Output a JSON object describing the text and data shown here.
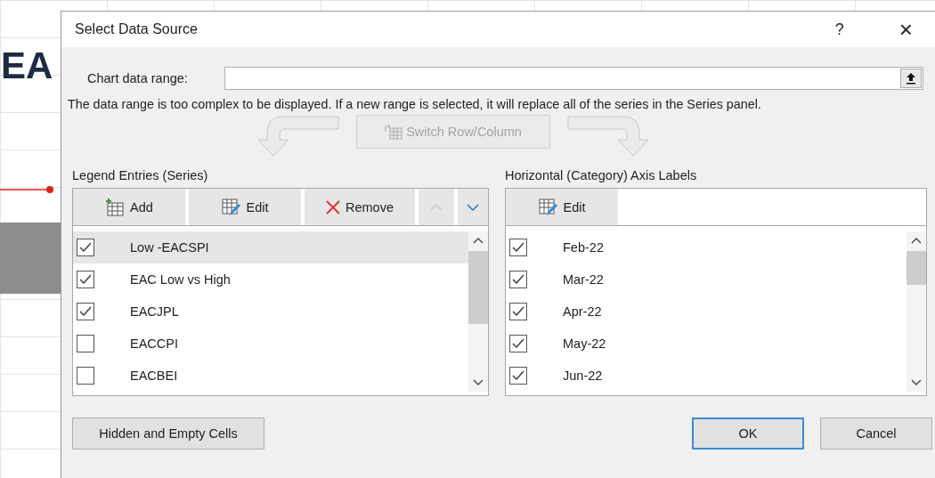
{
  "background": {
    "heading_fragment": "EA"
  },
  "window": {
    "title": "Select Data Source",
    "help": "?",
    "close": "×"
  },
  "chart_data_range": {
    "label": "Chart data range:"
  },
  "message": "The data range is too complex to be displayed. If a new range is selected, it will replace all of the series in the Series panel.",
  "switch_button": {
    "label": "Switch Row/Column",
    "disabled": true
  },
  "legend_entries": {
    "label": "Legend Entries (Series)",
    "toolbar": [
      {
        "kind": "add",
        "label": "Add"
      },
      {
        "kind": "edit",
        "label": "Edit"
      },
      {
        "kind": "remove",
        "label": "Remove"
      },
      {
        "kind": "up",
        "disabled": true
      },
      {
        "kind": "down",
        "disabled": false
      }
    ],
    "items": [
      {
        "label": "Low -EACSPI",
        "checked": true,
        "selected": true
      },
      {
        "label": "EAC Low vs High",
        "checked": true,
        "selected": false
      },
      {
        "label": "EACJPL",
        "checked": true,
        "selected": false
      },
      {
        "label": "EACCPI",
        "checked": false,
        "selected": false
      },
      {
        "label": "EACBEI",
        "checked": false,
        "selected": false
      }
    ]
  },
  "axis_labels": {
    "label": "Horizontal (Category) Axis Labels",
    "toolbar": [
      {
        "kind": "edit",
        "label": "Edit"
      }
    ],
    "items": [
      {
        "label": "Feb-22",
        "checked": true,
        "selected": false
      },
      {
        "label": "Mar-22",
        "checked": true,
        "selected": false
      },
      {
        "label": "Apr-22",
        "checked": true,
        "selected": false
      },
      {
        "label": "May-22",
        "checked": true,
        "selected": false
      },
      {
        "label": "Jun-22",
        "checked": true,
        "selected": false
      }
    ]
  },
  "footer_buttons": [
    {
      "label": "Hidden and Empty Cells",
      "default": false
    },
    {
      "label": "OK",
      "default": true
    },
    {
      "label": "Cancel",
      "default": false
    }
  ]
}
